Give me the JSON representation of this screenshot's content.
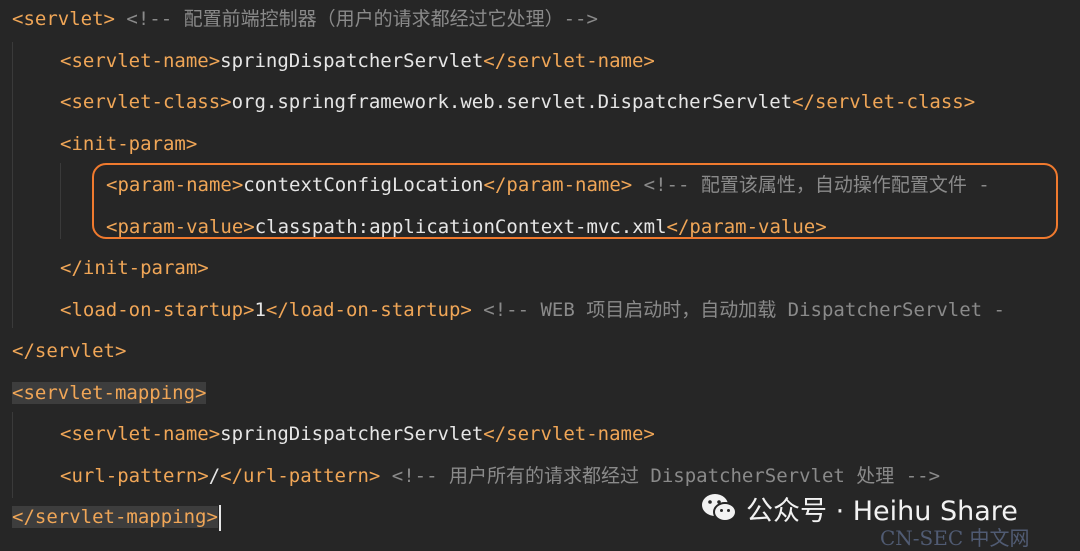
{
  "lines": [
    {
      "indent": 0,
      "open": "<servlet>",
      "text": "",
      "close": "",
      "comment": " <!-- 配置前端控制器（用户的请求都经过它处理）-->"
    },
    {
      "indent": 1,
      "open": "<servlet-name>",
      "text": "springDispatcherServlet",
      "close": "</servlet-name>",
      "comment": ""
    },
    {
      "indent": 1,
      "open": "<servlet-class>",
      "text": "org.springframework.web.servlet.DispatcherServlet",
      "close": "</servlet-class>",
      "comment": ""
    },
    {
      "indent": 1,
      "open": "<init-param>",
      "text": "",
      "close": "",
      "comment": ""
    },
    {
      "indent": 2,
      "open": "<param-name>",
      "text": "contextConfigLocation",
      "close": "</param-name>",
      "comment": " <!-- 配置该属性，自动操作配置文件 -"
    },
    {
      "indent": 2,
      "open": "<param-value>",
      "text": "classpath:applicationContext-mvc.xml",
      "close": "</param-value>",
      "comment": ""
    },
    {
      "indent": 1,
      "open": "</init-param>",
      "text": "",
      "close": "",
      "comment": ""
    },
    {
      "indent": 1,
      "open": "<load-on-startup>",
      "text": "1",
      "close": "</load-on-startup>",
      "comment": " <!-- WEB 项目启动时，自动加载 DispatcherServlet -"
    },
    {
      "indent": 0,
      "open": "</servlet>",
      "text": "",
      "close": "",
      "comment": ""
    },
    {
      "indent": 0,
      "open": "<servlet-mapping>",
      "text": "",
      "close": "",
      "comment": "",
      "highlight": true
    },
    {
      "indent": 1,
      "open": "<servlet-name>",
      "text": "springDispatcherServlet",
      "close": "</servlet-name>",
      "comment": ""
    },
    {
      "indent": 1,
      "open": "<url-pattern>",
      "text": "/",
      "close": "</url-pattern>",
      "comment": " <!-- 用户所有的请求都经过 DispatcherServlet 处理 -->"
    },
    {
      "indent": 0,
      "open": "</servlet-mapping>",
      "text": "",
      "close": "",
      "comment": "",
      "highlight": true,
      "caret": true
    }
  ],
  "watermark": {
    "icon": "wechat-icon",
    "text": "公众号 · Heihu Share"
  },
  "site_mark": "CN-SEC 中文网",
  "colors": {
    "background": "#262626",
    "tag": "#f0a657",
    "text": "#e6e6e6",
    "comment": "#8a8a8a",
    "box": "#f07a2e"
  }
}
